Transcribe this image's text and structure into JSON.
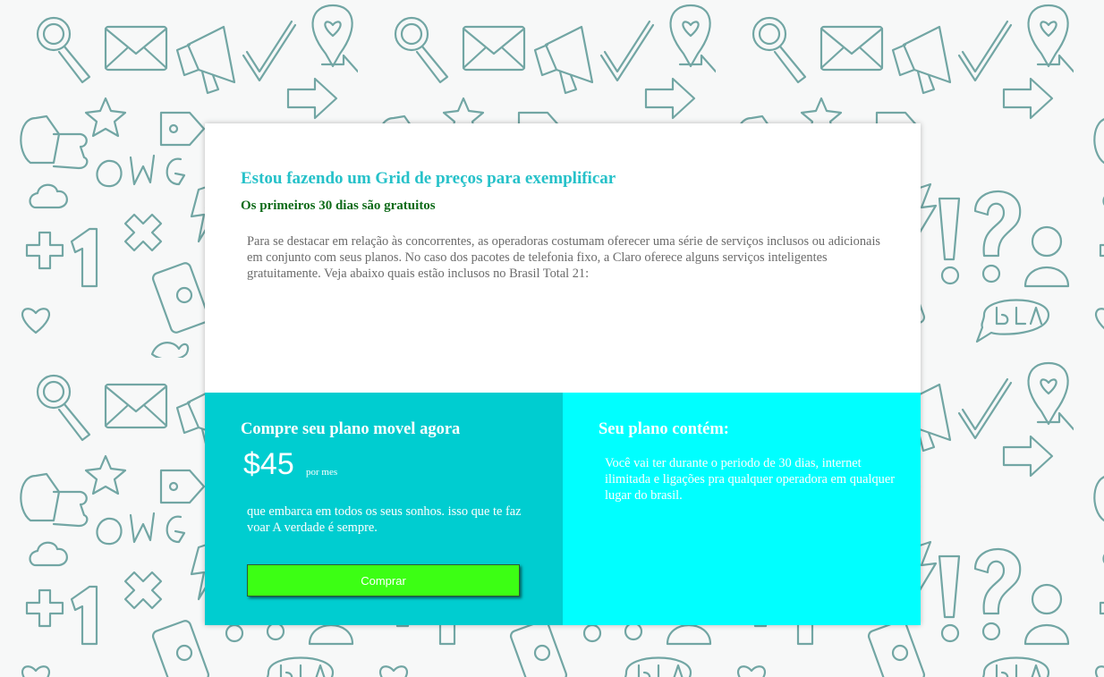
{
  "header": {
    "title": "Estou fazendo um Grid de preços para exemplificar",
    "subtitle": "Os primeiros 30 dias são gratuitos",
    "intro": "Para se destacar em relação às concorrentes, as operadoras costumam oferecer uma série de serviços inclusos ou adicionais em conjunto com seus planos. No caso dos pacotes de telefonia fixo, a Claro oferece alguns serviços inteligentes gratuitamente. Veja abaixo quais estão inclusos no Brasil Total 21:"
  },
  "plan": {
    "title": "Compre seu plano movel agora",
    "price": "$45",
    "period": "por mes",
    "description": "que embarca em todos os seus sonhos. isso que te faz voar A verdade é sempre.",
    "button_label": "Comprar"
  },
  "contents": {
    "title": "Seu plano contém:",
    "description": "Você vai ter durante o periodo de 30 dias, internet ilimitada e ligações pra qualquer operadora em qualquer lugar do brasil."
  },
  "colors": {
    "heading": "#26c1c9",
    "subheading": "#0e6b19",
    "panel_left": "#00cdd0",
    "panel_right": "#00ffff",
    "button": "#3cff14"
  },
  "background": {
    "pattern_icons": [
      "magnifier-icon",
      "envelope-icon",
      "megaphone-icon",
      "checkmark-icon",
      "heart-pin-icon",
      "thumbs-up-icon",
      "question-mark-icon",
      "exclamation-mark-icon",
      "omg-text-icon",
      "bla-bubble-icon",
      "arrow-icon",
      "star-icon",
      "cloud-icon",
      "phone-icon",
      "plus-icon",
      "number-one-icon",
      "tag-icon",
      "bird-icon",
      "person-icon",
      "lightning-icon",
      "cross-icon"
    ]
  }
}
